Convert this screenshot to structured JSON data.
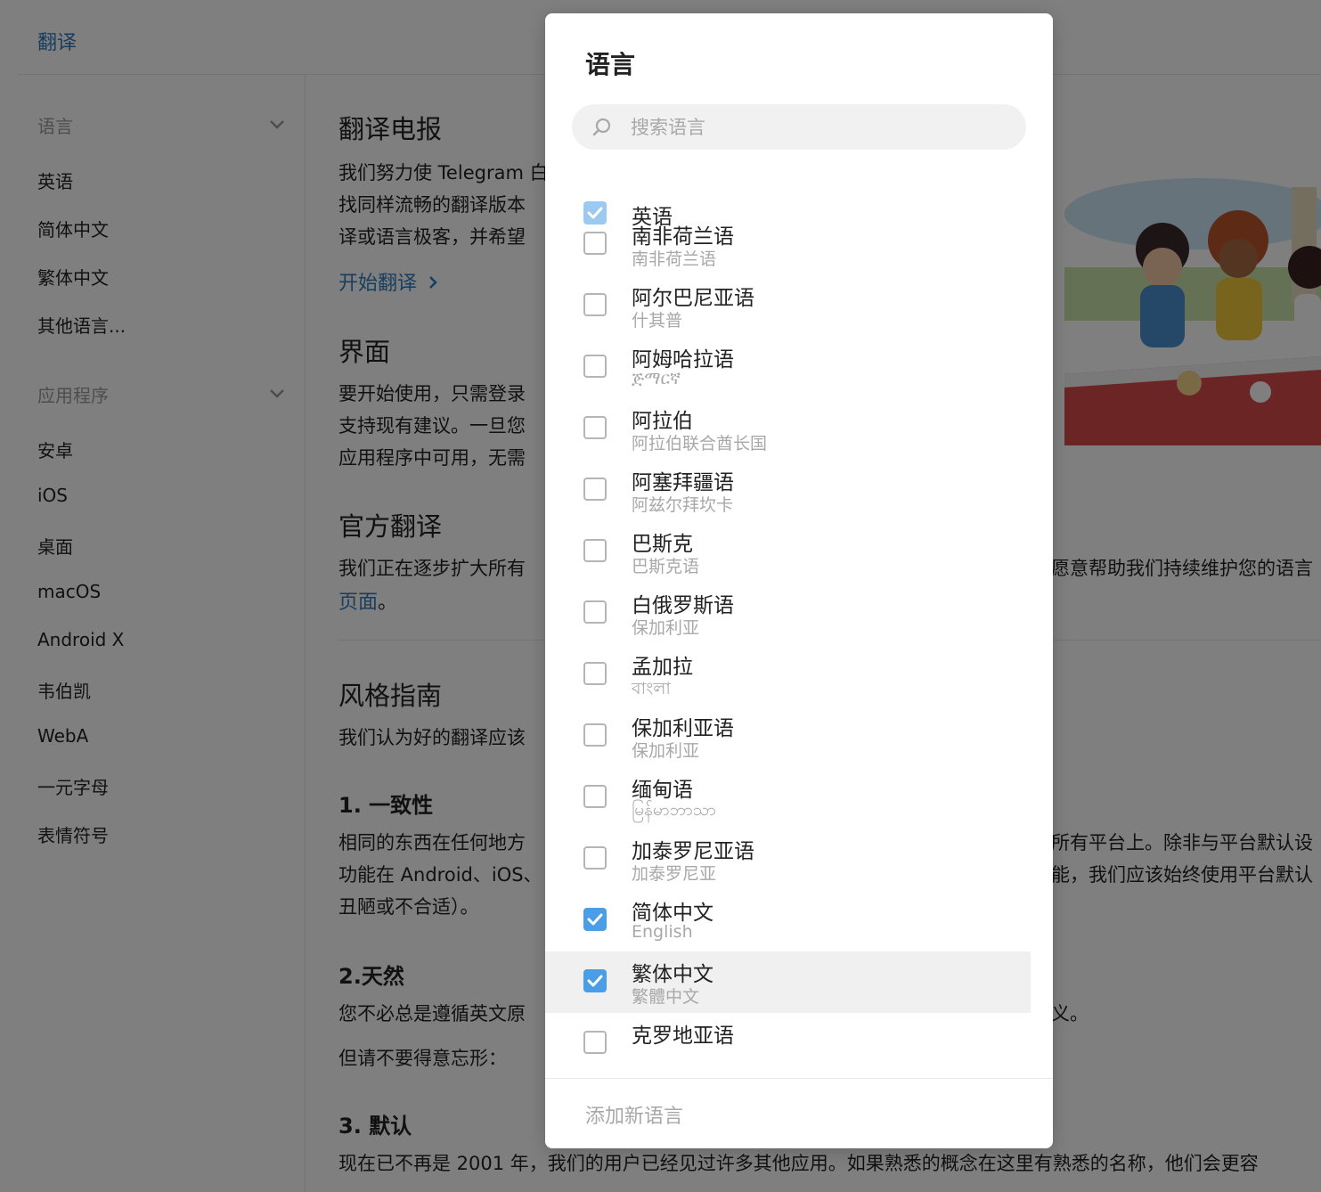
{
  "topbar": {
    "title": "翻译"
  },
  "sidebar": {
    "section_language": "语言",
    "language_items": [
      "英语",
      "简体中文",
      "繁体中文",
      "其他语言..."
    ],
    "section_apps": "应用程序",
    "app_items": [
      "安卓",
      "iOS",
      "桌面",
      "macOS",
      "Android X",
      "韦伯凯",
      "WebA",
      "一元字母",
      "表情符号"
    ]
  },
  "content": {
    "h_translate": "翻译电报",
    "p1_l1": "我们努力使 Telegram 白",
    "p1_l2": "找同样流畅的翻译版本",
    "p1_l3": "译或语言极客，并希望",
    "start_link": "开始翻译",
    "h_interface": "界面",
    "p2_l1": "要开始使用，只需登录",
    "p2_l2": "支持现有建议。一旦您",
    "p2_l3": "应用程序中可用，无需",
    "h_official": "官方翻译",
    "p3_l1a": "我们正在逐步扩大所有",
    "p3_l1b": "愿意帮助我们持续维护您的语言",
    "p3_link": "页面",
    "p3_tail": "。",
    "h_style": "风格指南",
    "p4_l1": "我们认为好的翻译应该",
    "h_consistency": "1. 一致性",
    "p5_l1a": "相同的东西在任何地方",
    "p5_l1b": "所有平台上。除非与平台默认设",
    "p5_l2a": "功能在 Android、iOS、",
    "p5_l2b": "能，我们应该始终使用平台默认",
    "p5_l3": "丑陋或不合适）。",
    "h_natural": "2.天然",
    "p6_l1a": "您不必总是遵循英文原",
    "p6_l1b": "义。",
    "p6_l2": "但请不要得意忘形：",
    "h_default": "3. 默认",
    "p7_l1": "现在已不再是 2001 年，我们的用户已经见过许多其他应用。如果熟悉的概念在这里有熟悉的名称，他们会更容"
  },
  "modal": {
    "title": "语言",
    "search_placeholder": "搜索语言",
    "search_value": "",
    "add_language": "添加新语言",
    "languages": [
      {
        "name": "英语",
        "native": "",
        "checked": true,
        "disabled": true
      },
      {
        "name": "南非荷兰语",
        "native": "南非荷兰语",
        "checked": false
      },
      {
        "name": "阿尔巴尼亚语",
        "native": "什其普",
        "checked": false
      },
      {
        "name": "阿姆哈拉语",
        "native": "ጅማርኛ",
        "checked": false
      },
      {
        "name": "阿拉伯",
        "native": "阿拉伯联合酋长国",
        "checked": false
      },
      {
        "name": "阿塞拜疆语",
        "native": "阿兹尔拜坎卡",
        "checked": false
      },
      {
        "name": "巴斯克",
        "native": "巴斯克语",
        "checked": false
      },
      {
        "name": "白俄罗斯语",
        "native": "保加利亚",
        "checked": false
      },
      {
        "name": "孟加拉",
        "native": "বাংলা",
        "checked": false
      },
      {
        "name": "保加利亚语",
        "native": "保加利亚",
        "checked": false
      },
      {
        "name": "缅甸语",
        "native": "မြန်မာဘာသာ",
        "checked": false
      },
      {
        "name": "加泰罗尼亚语",
        "native": "加泰罗尼亚",
        "checked": false
      },
      {
        "name": "简体中文",
        "native": "English",
        "checked": true
      },
      {
        "name": "繁体中文",
        "native": "繁體中文",
        "checked": true,
        "hover": true
      },
      {
        "name": "克罗地亚语",
        "native": "",
        "checked": false
      }
    ]
  }
}
